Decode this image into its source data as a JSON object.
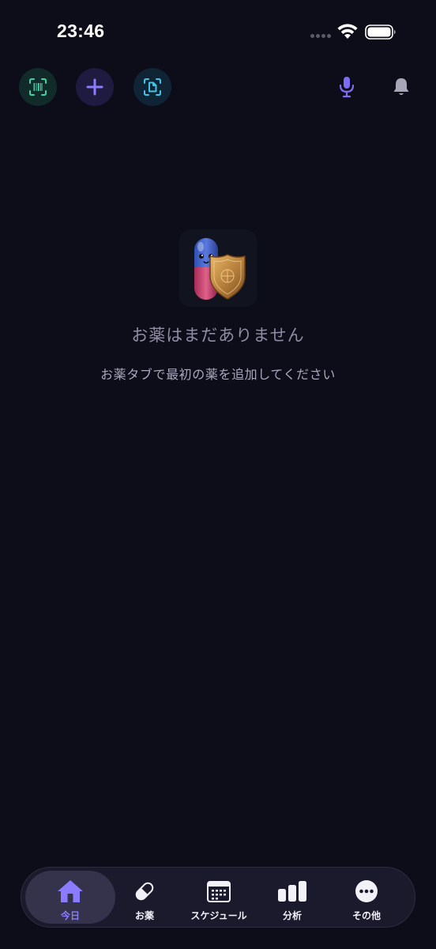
{
  "status_bar": {
    "time": "23:46"
  },
  "top_bar": {
    "barcode_icon": "barcode-scan-icon",
    "add_icon": "plus-icon",
    "document_scan_icon": "document-scan-icon",
    "mic_icon": "microphone-icon",
    "bell_icon": "bell-icon"
  },
  "empty_state": {
    "title": "お薬はまだありません",
    "subtitle": "お薬タブで最初の薬を追加してください",
    "illustration": "pill-with-shield-illustration"
  },
  "tab_bar": {
    "tabs": [
      {
        "label": "今日",
        "icon": "home-icon",
        "active": true
      },
      {
        "label": "お薬",
        "icon": "pill-icon",
        "active": false
      },
      {
        "label": "スケジュール",
        "icon": "calendar-icon",
        "active": false
      },
      {
        "label": "分析",
        "icon": "bar-chart-icon",
        "active": false
      },
      {
        "label": "その他",
        "icon": "more-icon",
        "active": false
      }
    ]
  },
  "colors": {
    "background": "#0d0c19",
    "accent": "#8b7bff",
    "barcode_green": "#3ed3a0",
    "scan_cyan": "#3fc6e6",
    "tab_bar_bg": "#1b1a2c"
  }
}
